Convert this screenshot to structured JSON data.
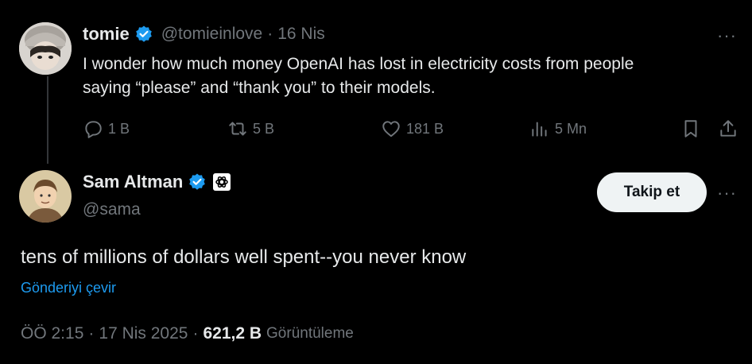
{
  "reply_to": {
    "display_name": "tomie",
    "handle": "@tomieinlove",
    "separator": "·",
    "date": "16 Nis",
    "text_line1": "I wonder how much money OpenAI has lost in electricity costs from people",
    "text_line2": "saying “please” and “thank you” to their models.",
    "replies": "1 B",
    "reposts": "5 B",
    "likes": "181 B",
    "views": "5 Mn",
    "more": "···"
  },
  "main_tweet": {
    "display_name": "Sam Altman",
    "handle": "@sama",
    "follow_label": "Takip et",
    "more": "···",
    "text": "tens of millions of dollars well spent--you never know",
    "translate_label": "Gönderiyi çevir",
    "time": "ÖÖ 2:15",
    "date": "17 Nis 2025",
    "sep1": "·",
    "sep2": "·",
    "views_count": "621,2 B",
    "views_label": "Görüntüleme"
  },
  "colors": {
    "background": "#000000",
    "text": "#e7e9ea",
    "muted": "#71767b",
    "link": "#1d9bf0",
    "verified": "#1d9bf0"
  }
}
